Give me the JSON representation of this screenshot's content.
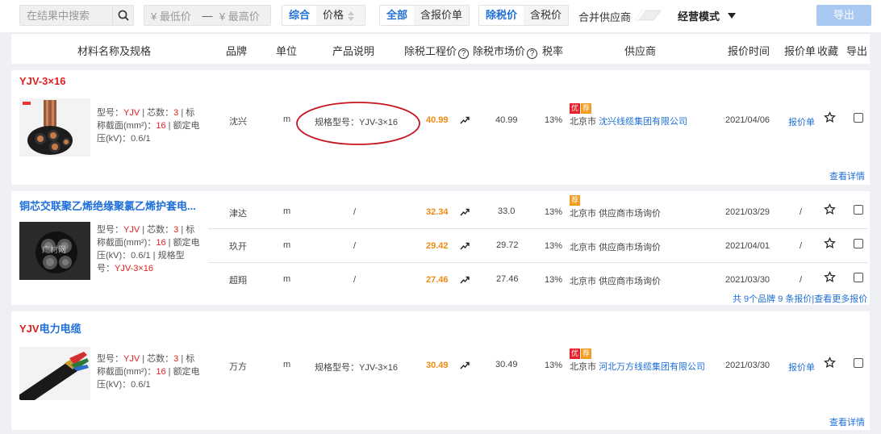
{
  "toolbar": {
    "search_placeholder": "在结果中搜索",
    "price_min": "¥ 最低价",
    "price_dash": "—",
    "price_max": "¥ 最高价",
    "sort_composite": "综合",
    "sort_price": "价格",
    "filter_all": "全部",
    "filter_quote": "含报价单",
    "tax_excl": "除税价",
    "tax_incl": "含税价",
    "merge_suppliers": "合并供应商",
    "mode": "经营模式",
    "export": "导出"
  },
  "header": {
    "name": "材料名称及规格",
    "brand": "品牌",
    "unit": "单位",
    "desc": "产品说明",
    "eng_price": "除税工程价",
    "market_price": "除税市场价",
    "tax": "税率",
    "supplier": "供应商",
    "time": "报价时间",
    "quote": "报价单",
    "fav": "收藏",
    "export": "导出"
  },
  "colors": {
    "accent": "#1e6fd9",
    "price": "#f08a10",
    "highlight": "#e02020",
    "annotation": "#c8141e"
  },
  "cards": [
    {
      "title_red": "YJV-3×16",
      "title_blue": "",
      "spec": {
        "l_model": "型号：",
        "model": "YJV",
        "l_cores": " | 芯数：",
        "cores": "3",
        "l_area": " | 标称截面(mm²)：",
        "area": "16",
        "l_volt": " | 额定电压(kV)：0.6/1",
        "l_spec": "",
        "spec_val": ""
      },
      "rows": [
        {
          "brand": "沈兴",
          "unit": "m",
          "desc": "规格型号：YJV-3×16",
          "eng": "40.99",
          "market": "40.99",
          "tax": "13%",
          "city": "北京市",
          "supplier": "沈兴线缆集团有限公司",
          "supplier_link": true,
          "badge_you": "优",
          "badge_jian": "荐",
          "time": "2021/04/06",
          "quote": "报价单"
        }
      ],
      "footer": "查看详情"
    },
    {
      "title_red": "",
      "title_blue": "铜芯交联聚乙烯绝缘聚氯乙烯护套电...",
      "spec": {
        "l_model": "型号：",
        "model": "YJV",
        "l_cores": " | 芯数：",
        "cores": "3",
        "l_area": " | 标称截面(mm²)：",
        "area": "16",
        "l_volt": " | 额定电压(kV)：0.6/1 | 规格型号：",
        "l_spec": "",
        "spec_val": "YJV-3×16"
      },
      "thumb_watermark": "广材网",
      "rows": [
        {
          "brand": "津达",
          "unit": "m",
          "desc": "/",
          "eng": "32.34",
          "market": "33.0",
          "tax": "13%",
          "city": "北京市",
          "supplier": "供应商市场询价",
          "supplier_link": false,
          "badge_you": "",
          "badge_jian": "荐",
          "time": "2021/03/29",
          "quote": "/"
        },
        {
          "brand": "玖开",
          "unit": "m",
          "desc": "/",
          "eng": "29.42",
          "market": "29.72",
          "tax": "13%",
          "city": "北京市",
          "supplier": "供应商市场询价",
          "supplier_link": false,
          "badge_you": "",
          "badge_jian": "",
          "time": "2021/04/01",
          "quote": "/"
        },
        {
          "brand": "超翔",
          "unit": "m",
          "desc": "/",
          "eng": "27.46",
          "market": "27.46",
          "tax": "13%",
          "city": "北京市",
          "supplier": "供应商市场询价",
          "supplier_link": false,
          "badge_you": "",
          "badge_jian": "",
          "time": "2021/03/30",
          "quote": "/"
        }
      ],
      "footer": "共 9个品牌 9 条报价|查看更多报价"
    },
    {
      "title_red": "YJV",
      "title_blue": "电力电缆",
      "spec": {
        "l_model": "型号：",
        "model": "YJV",
        "l_cores": " | 芯数：",
        "cores": "3",
        "l_area": " | 标称截面(mm²)：",
        "area": "16",
        "l_volt": " | 额定电压(kV)：0.6/1",
        "l_spec": "",
        "spec_val": ""
      },
      "rows": [
        {
          "brand": "万方",
          "unit": "m",
          "desc": "规格型号：YJV-3×16",
          "eng": "30.49",
          "market": "30.49",
          "tax": "13%",
          "city": "北京市",
          "supplier": "河北万方线缆集团有限公司",
          "supplier_link": true,
          "badge_you": "优",
          "badge_jian": "荐",
          "time": "2021/03/30",
          "quote": "报价单"
        }
      ],
      "footer": "查看详情"
    }
  ]
}
